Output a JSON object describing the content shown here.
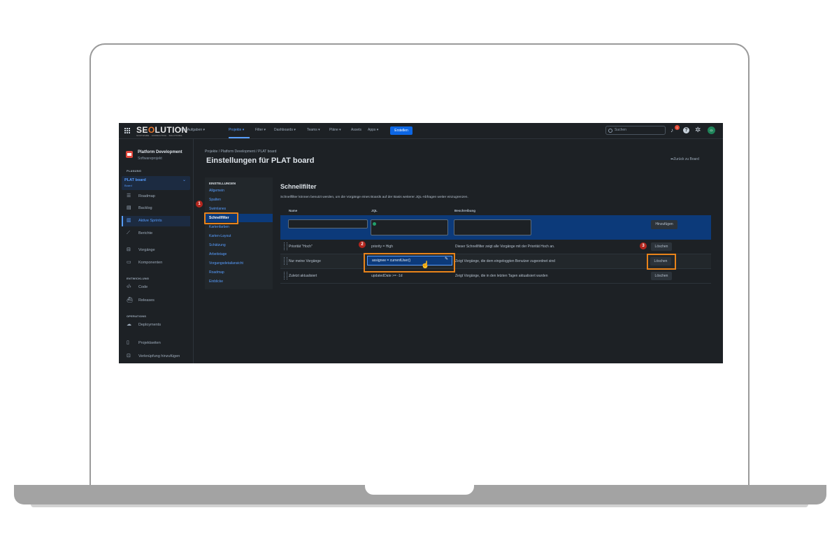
{
  "topnav": {
    "logo_main": "SEOLUTION",
    "logo_sub": "SOFTWARE · CONSULTING · SOLUTIONS",
    "items": [
      "Ihre Aufgaben ▾",
      "Projekte ▾",
      "Filter ▾",
      "Dashboards ▾",
      "Teams ▾",
      "Pläne ▾",
      "Assets",
      "Apps ▾"
    ],
    "create_label": "Erstellen",
    "search_placeholder": "Suchen",
    "notification_count": "1",
    "avatar_initials": "CI"
  },
  "sidebar": {
    "project_title": "Platform Development",
    "project_subtitle": "Softwareprojekt",
    "section_planning": "PLANUNG",
    "board_title": "PLAT board",
    "board_subtitle": "Board",
    "items": [
      {
        "label": "Roadmap",
        "icon": "roadmap-icon"
      },
      {
        "label": "Backlog",
        "icon": "backlog-icon"
      },
      {
        "label": "Aktive Sprints",
        "icon": "sprint-board-icon"
      },
      {
        "label": "Berichte",
        "icon": "chart-icon"
      },
      {
        "label": "Vorgänge",
        "icon": "issues-icon"
      },
      {
        "label": "Komponenten",
        "icon": "components-icon"
      },
      {
        "label": "Code",
        "icon": "code-icon"
      },
      {
        "label": "Releases",
        "icon": "ship-icon"
      },
      {
        "label": "Deployments",
        "icon": "deploy-icon"
      },
      {
        "label": "Projektseiten",
        "icon": "page-icon"
      },
      {
        "label": "Verknüpfung hinzufügen",
        "icon": "add-link-icon"
      }
    ],
    "section_development": "ENTWICKLUNG",
    "section_operations": "OPERATIONS"
  },
  "main": {
    "breadcrumb": "Projekte  /  Platform Development  /  PLAT board",
    "title": "Einstellungen für PLAT board",
    "back_link": "⬅Zurück zu Board"
  },
  "settings": {
    "heading": "EINSTELLUNGEN",
    "items": [
      "Allgemein",
      "Spalten",
      "Swimlanes",
      "Schnellfilter",
      "Kartenfarben",
      "Karten-Layout",
      "Schätzung",
      "Arbeitstage",
      "Vorgangsdetailansicht",
      "Roadmap",
      "Einblicke"
    ],
    "active_item": "Schnellfilter"
  },
  "schnellfilter": {
    "title": "Schnellfilter",
    "description": "Schnellfilter können benutzt werden, um die Vorgänge eines Boards auf der Basis weiterer JQL-Abfragen weiter einzugrenzen.",
    "columns": {
      "name": "Name",
      "jql": "JQL",
      "description": "Beschreibung"
    },
    "add_label": "Hinzufügen",
    "delete_label": "Löschen",
    "rows": [
      {
        "name": "Priorität \"Hoch\"",
        "jql": "priority = High",
        "description": "Dieser Schnellfilter zeigt alle Vorgänge mit der Priorität Hoch an."
      },
      {
        "name": "Nur meine Vorgänge",
        "jql": "assignee = currentUser()",
        "description": "Zeigt Vorgänge, die dem eingeloggten Benutzer zugeordnet sind"
      },
      {
        "name": "Zuletzt aktualisiert",
        "jql": "updatedDate >= -1d",
        "description": "Zeigt Vorgänge, die in den letzten Tagen aktualisiert wurden"
      }
    ]
  },
  "markers": [
    "1",
    "2",
    "3"
  ],
  "colors": {
    "accent": "#579dff",
    "highlight": "#e8831a",
    "marker": "#b3261e",
    "background": "#1d2125"
  }
}
